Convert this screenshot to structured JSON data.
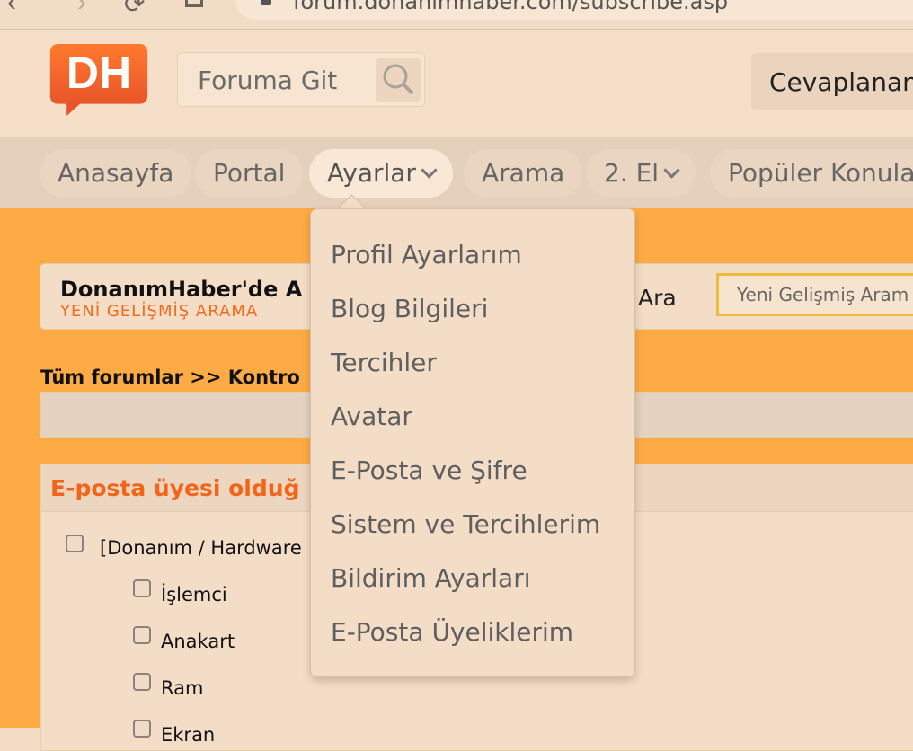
{
  "browser": {
    "url": "forum.donanimhaber.com/subscribe.asp",
    "back_glyph": "‹",
    "forward_glyph": "›",
    "reload_glyph": "⟳"
  },
  "header": {
    "logo_text": "DH",
    "search_placeholder": "Foruma Git",
    "unanswered_label": "Cevaplanan"
  },
  "nav": {
    "tabs": [
      {
        "label": "Anasayfa"
      },
      {
        "label": "Portal"
      },
      {
        "label": "Ayarlar"
      },
      {
        "label": "Arama"
      },
      {
        "label": "2. El"
      },
      {
        "label": "Popüler Konula"
      }
    ]
  },
  "search_panel": {
    "title": "DonanımHaber'de A",
    "subtitle": "YENİ GELİŞMİŞ ARAMA",
    "ara_label": "Ara",
    "input_placeholder": "Yeni Gelişmiş Aram"
  },
  "breadcrumb": "Tüm forumlar >> Kontro",
  "subscriptions": {
    "title": "E-posta üyesi olduğ",
    "items": [
      {
        "label": "[Donanım / Hardware"
      },
      {
        "label": "İşlemci"
      },
      {
        "label": "Anakart"
      },
      {
        "label": "Ram"
      },
      {
        "label": "Ekran"
      }
    ]
  },
  "dropdown": {
    "items": [
      {
        "label": "Profil Ayarlarım"
      },
      {
        "label": "Blog Bilgileri"
      },
      {
        "label": "Tercihler"
      },
      {
        "label": "Avatar"
      },
      {
        "label": "E-Posta ve Şifre"
      },
      {
        "label": "Sistem ve Tercihlerim"
      },
      {
        "label": "Bildirim Ayarları"
      },
      {
        "label": "E-Posta Üyeliklerim"
      }
    ]
  },
  "colors": {
    "brand_orange": "#f26a1b",
    "page_orange": "#ffab45"
  }
}
